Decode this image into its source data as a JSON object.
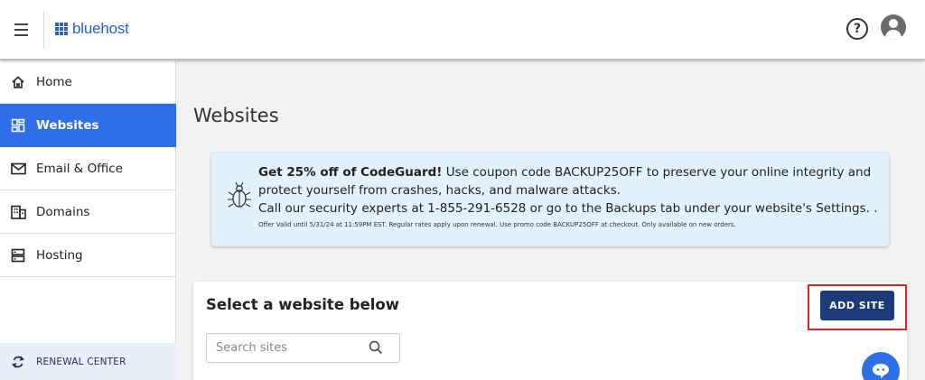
{
  "header": {
    "logo_text": "bluehost",
    "help_label": "?",
    "brand_color": "#2e5cd6"
  },
  "sidebar": {
    "items": [
      {
        "label": "Home",
        "icon": "home-icon"
      },
      {
        "label": "Websites",
        "icon": "websites-grid-icon",
        "active": true
      },
      {
        "label": "Email & Office",
        "icon": "envelope-icon"
      },
      {
        "label": "Domains",
        "icon": "building-icon"
      },
      {
        "label": "Hosting",
        "icon": "server-icon"
      }
    ],
    "renewal_label": "RENEWAL CENTER",
    "active_color": "#2e6ee6"
  },
  "main": {
    "page_title": "Websites",
    "banner": {
      "headline": "Get 25% off of CodeGuard!",
      "text_1": " Use coupon code BACKUP25OFF to preserve your online integrity and protect yourself from crashes, hacks, and malware attacks.",
      "text_2": "Call our security experts at 1-855-291-6528 or go to the Backups tab under your website's Settings. .",
      "fine_print": "Offer Valid until 5/31/24 at 11:59PM EST. Regular rates apply upon renewal. Use promo code BACKUP25OFF at checkout. Only available on new orders.",
      "icon": "bug-icon",
      "background": "#e2f1fb"
    },
    "card": {
      "title": "Select a website below",
      "add_site_label": "ADD SITE",
      "search_placeholder": "Search sites",
      "button_color": "#1a3a78",
      "highlight_color": "#e0252a"
    }
  },
  "chat": {
    "icon": "chat-bubble-icon"
  }
}
